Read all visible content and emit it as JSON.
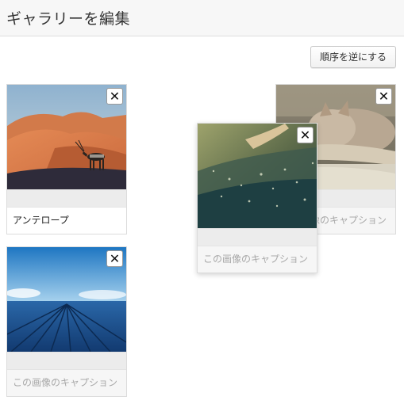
{
  "header": {
    "title": "ギャラリーを編集"
  },
  "toolbar": {
    "reverse_label": "順序を逆にする"
  },
  "close_glyph": "✕",
  "items": [
    {
      "image": "antelope-desert",
      "caption": "アンテロープ"
    },
    {
      "image": "cat-sleeping",
      "caption": "この画像のキャプション"
    },
    {
      "image": "water-sparkle",
      "caption": "この画像のキャプション"
    },
    {
      "image": "ocean-boardwalk",
      "caption": "この画像のキャプション"
    }
  ]
}
